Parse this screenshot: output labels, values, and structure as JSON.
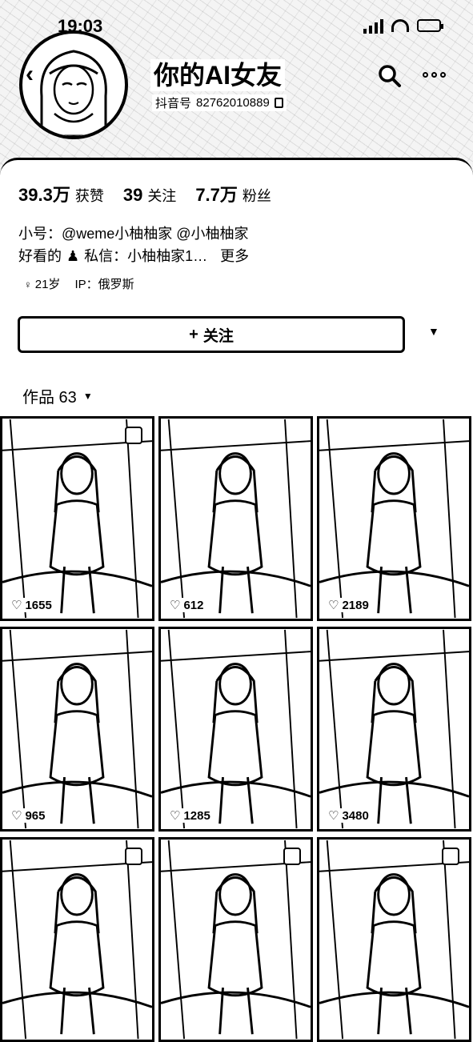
{
  "status_bar": {
    "time": "19:03"
  },
  "profile": {
    "name": "你的AI女友",
    "uid_label": "抖音号",
    "uid_value": "82762010889",
    "stats": [
      {
        "num": "39.3万",
        "label": "获赞"
      },
      {
        "num": "39",
        "label": "关注"
      },
      {
        "num": "7.7万",
        "label": "粉丝"
      }
    ],
    "bio_line1": "小号：@weme小柚柚家 @小柚柚家",
    "bio_line2_a": "好看的",
    "bio_line2_b": "私信：小柚柚家1…",
    "bio_more": "更多",
    "age": "21岁",
    "ip": "IP：俄罗斯"
  },
  "actions": {
    "follow_label": "关注",
    "follow_icon": "plus-icon",
    "dropdown_icon": "caret-down-icon"
  },
  "works": {
    "tab_label": "作品 63"
  },
  "videos": [
    {
      "likes": "1655",
      "selectable": true
    },
    {
      "likes": "612",
      "selectable": false
    },
    {
      "likes": "2189",
      "selectable": false
    },
    {
      "likes": "965",
      "selectable": false
    },
    {
      "likes": "1285",
      "selectable": false
    },
    {
      "likes": "3480",
      "selectable": false
    },
    {
      "likes": "",
      "selectable": true
    },
    {
      "likes": "",
      "selectable": true
    },
    {
      "likes": "",
      "selectable": true
    }
  ]
}
